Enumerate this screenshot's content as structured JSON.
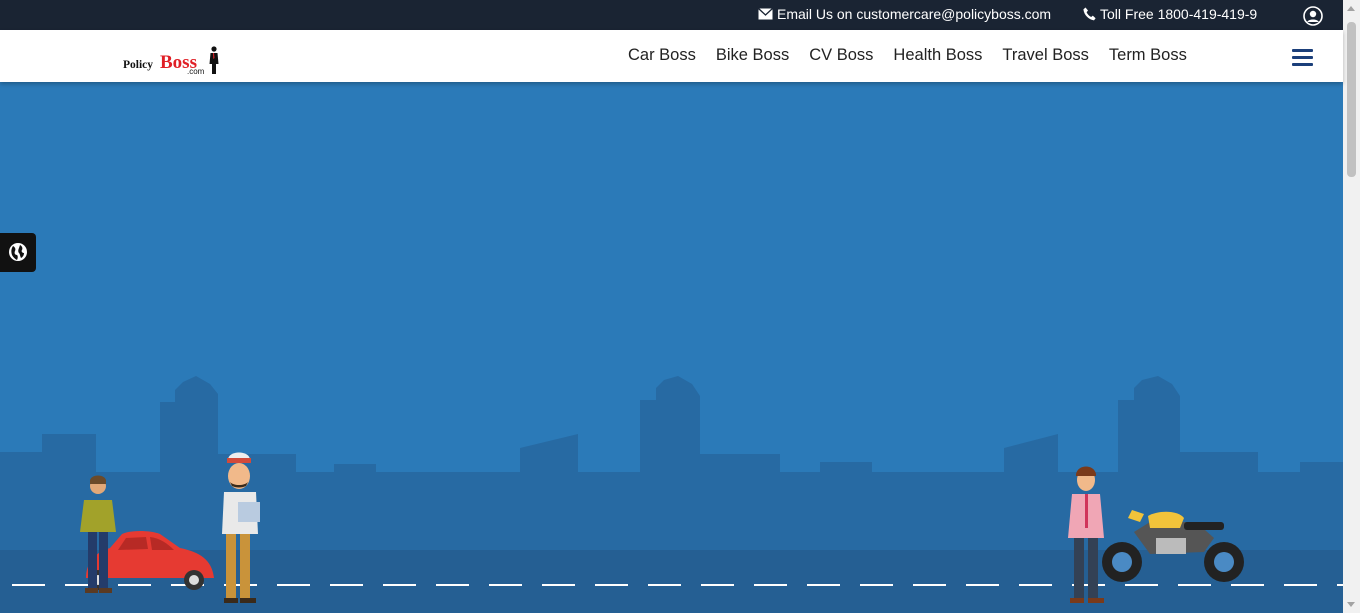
{
  "topbar": {
    "email_text": "Email Us on customercare@policyboss.com",
    "phone_text": "Toll Free 1800-419-419-9"
  },
  "logo": {
    "text_policy": "Policy",
    "text_boss": "Boss",
    "text_com": ".com"
  },
  "nav": {
    "items": [
      "Car Boss",
      "Bike Boss",
      "CV Boss",
      "Health Boss",
      "Travel Boss",
      "Term Boss"
    ]
  },
  "colors": {
    "topbar_bg": "#1a2433",
    "hero_bg": "#2b7ab8",
    "skyline": "#276aa3",
    "road": "#255f93",
    "brand_red": "#e01f26",
    "nav_accent": "#1b3f7a"
  },
  "icons": [
    "envelope-icon",
    "phone-icon",
    "user-account-icon",
    "hamburger-menu-icon",
    "globe-icon"
  ]
}
